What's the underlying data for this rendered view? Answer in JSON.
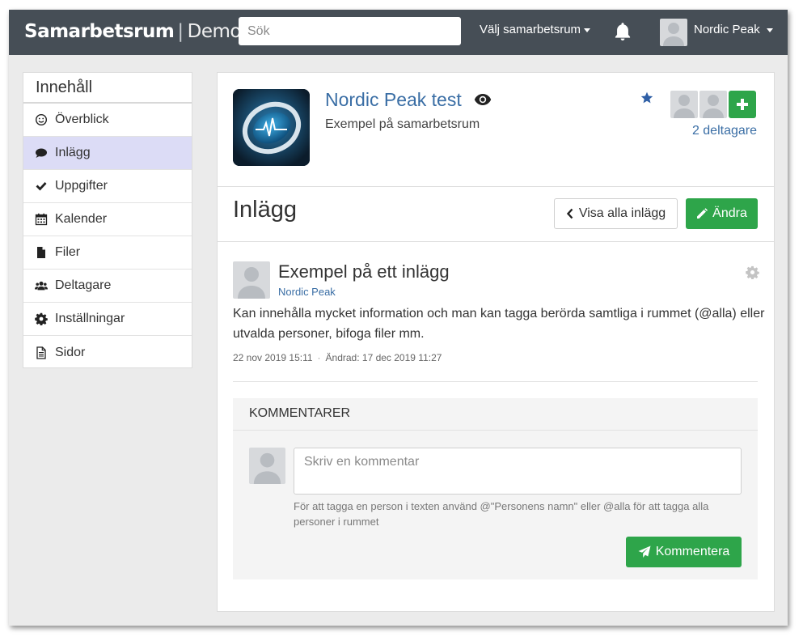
{
  "header": {
    "brand_bold": "Samarbetsrum",
    "brand_sep": "|",
    "brand_light": "Demo",
    "search_placeholder": "Sök",
    "room_selector": "Välj samarbetsrum",
    "user_name": "Nordic Peak"
  },
  "sidebar": {
    "title": "Innehåll",
    "items": [
      {
        "label": "Överblick",
        "icon": "smiley-icon"
      },
      {
        "label": "Inlägg",
        "icon": "comment-icon",
        "active": true
      },
      {
        "label": "Uppgifter",
        "icon": "check-icon"
      },
      {
        "label": "Kalender",
        "icon": "calendar-icon"
      },
      {
        "label": "Filer",
        "icon": "file-icon"
      },
      {
        "label": "Deltagare",
        "icon": "users-icon"
      },
      {
        "label": "Inställningar",
        "icon": "gear-icon"
      },
      {
        "label": "Sidor",
        "icon": "document-icon"
      }
    ]
  },
  "room": {
    "title": "Nordic Peak test",
    "subtitle": "Exempel på samarbetsrum",
    "participants": "2 deltagare"
  },
  "section": {
    "title": "Inlägg",
    "view_all": "Visa alla inlägg",
    "edit": "Ändra"
  },
  "post": {
    "title": "Exempel på ett inlägg",
    "author": "Nordic Peak",
    "body": "Kan innehålla mycket information och man kan tagga berörda samtliga i rummet (@alla) eller utvalda personer, bifoga filer mm.",
    "created": "22 nov 2019 15:11",
    "modified": "Ändrad: 17 dec 2019 11:27"
  },
  "comments": {
    "header": "KOMMENTARER",
    "placeholder": "Skriv en kommentar",
    "help": "För att tagga en person i texten använd @\"Personens namn\" eller @alla för att tagga alla personer i rummet",
    "submit": "Kommentera"
  },
  "colors": {
    "topbar": "#464e56",
    "accent_green": "#2ea54a",
    "link_blue": "#3a6ea5",
    "active_item": "#dcdcf6"
  }
}
